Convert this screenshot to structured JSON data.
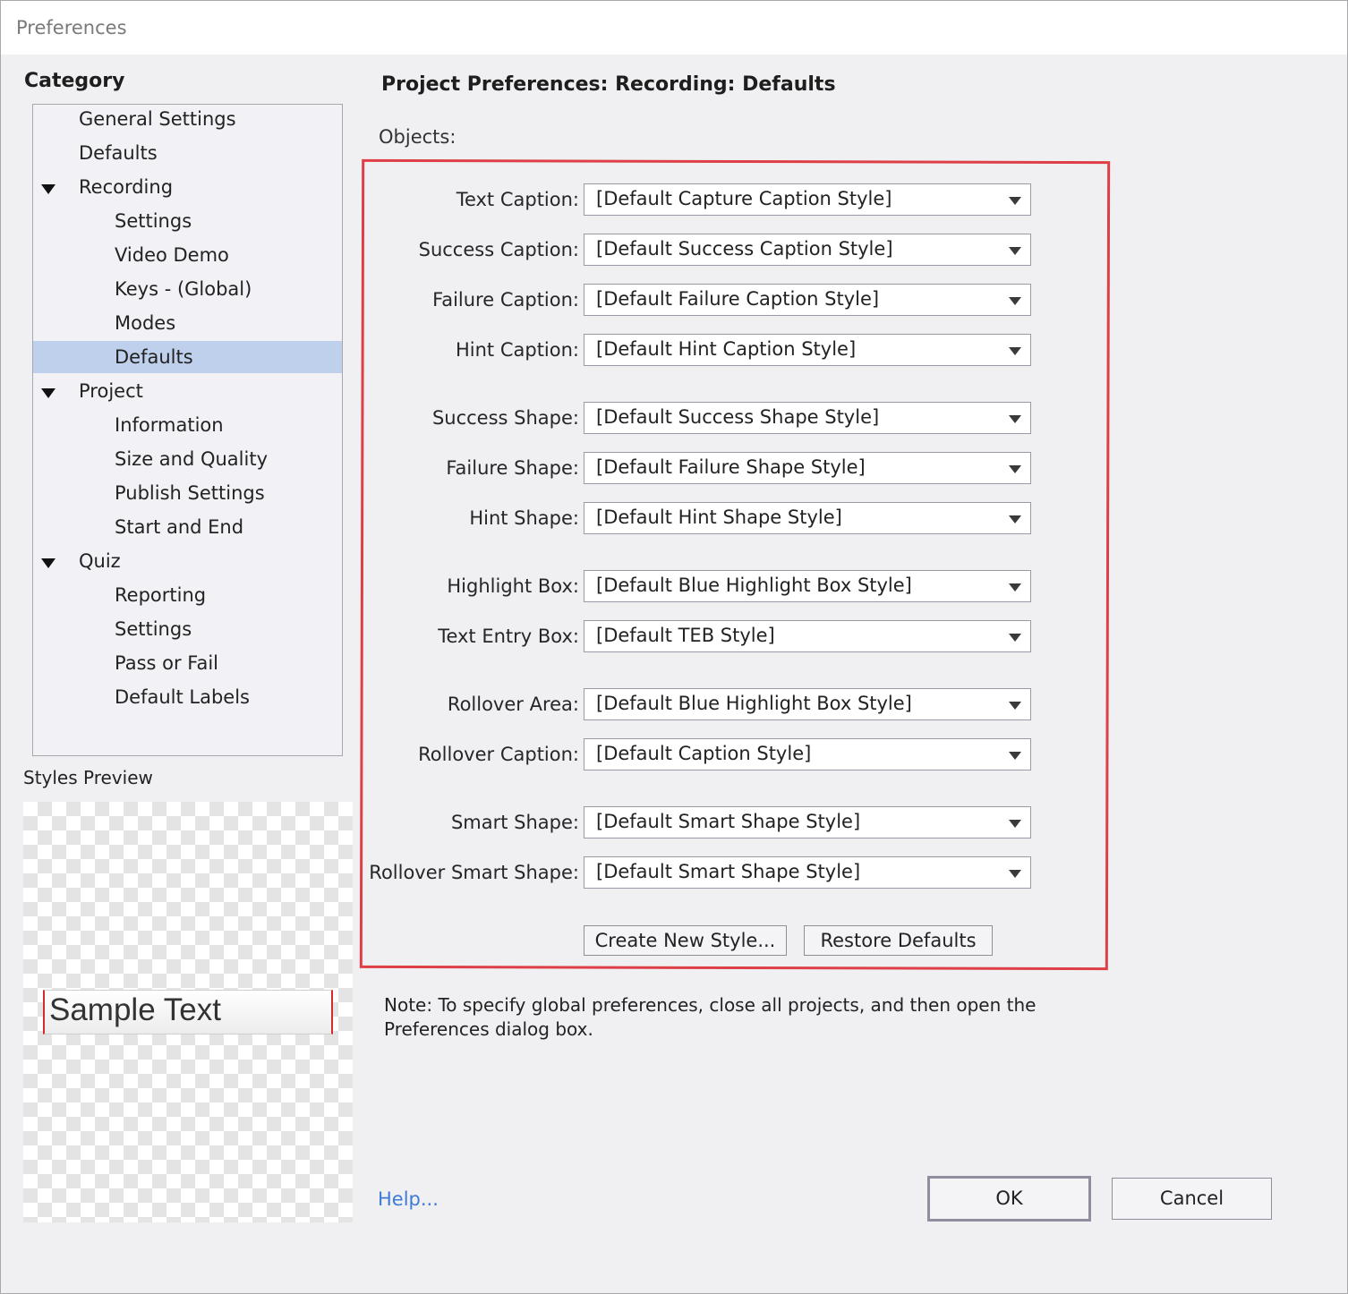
{
  "window": {
    "title": "Preferences"
  },
  "category": {
    "label": "Category",
    "items": [
      {
        "label": "General Settings",
        "level": 1,
        "expandable": false,
        "selected": false
      },
      {
        "label": "Defaults",
        "level": 1,
        "expandable": false,
        "selected": false
      },
      {
        "label": "Recording",
        "level": 1,
        "expandable": true,
        "selected": false
      },
      {
        "label": "Settings",
        "level": 2,
        "expandable": false,
        "selected": false
      },
      {
        "label": "Video Demo",
        "level": 2,
        "expandable": false,
        "selected": false
      },
      {
        "label": "Keys - (Global)",
        "level": 2,
        "expandable": false,
        "selected": false
      },
      {
        "label": "Modes",
        "level": 2,
        "expandable": false,
        "selected": false
      },
      {
        "label": "Defaults",
        "level": 2,
        "expandable": false,
        "selected": true
      },
      {
        "label": "Project",
        "level": 1,
        "expandable": true,
        "selected": false
      },
      {
        "label": "Information",
        "level": 2,
        "expandable": false,
        "selected": false
      },
      {
        "label": "Size and Quality",
        "level": 2,
        "expandable": false,
        "selected": false
      },
      {
        "label": "Publish Settings",
        "level": 2,
        "expandable": false,
        "selected": false
      },
      {
        "label": "Start and End",
        "level": 2,
        "expandable": false,
        "selected": false
      },
      {
        "label": "Quiz",
        "level": 1,
        "expandable": true,
        "selected": false
      },
      {
        "label": "Reporting",
        "level": 2,
        "expandable": false,
        "selected": false
      },
      {
        "label": "Settings",
        "level": 2,
        "expandable": false,
        "selected": false
      },
      {
        "label": "Pass or Fail",
        "level": 2,
        "expandable": false,
        "selected": false
      },
      {
        "label": "Default Labels",
        "level": 2,
        "expandable": false,
        "selected": false
      }
    ]
  },
  "styles_preview": {
    "label": "Styles Preview",
    "sample_text": "Sample Text"
  },
  "main": {
    "title": "Project Preferences: Recording: Defaults",
    "objects_label": "Objects:",
    "rows": [
      {
        "label": "Text Caption:",
        "value": "[Default Capture Caption Style]"
      },
      {
        "label": "Success Caption:",
        "value": "[Default Success Caption Style]"
      },
      {
        "label": "Failure Caption:",
        "value": "[Default Failure Caption Style]"
      },
      {
        "label": "Hint Caption:",
        "value": "[Default Hint Caption Style]"
      },
      {
        "label": "Success Shape:",
        "value": "[Default Success Shape Style]"
      },
      {
        "label": "Failure Shape:",
        "value": "[Default Failure Shape Style]"
      },
      {
        "label": "Hint Shape:",
        "value": "[Default Hint Shape Style]"
      },
      {
        "label": "Highlight Box:",
        "value": "[Default Blue Highlight Box Style]"
      },
      {
        "label": "Text Entry Box:",
        "value": "[Default TEB Style]"
      },
      {
        "label": "Rollover Area:",
        "value": "[Default Blue Highlight Box Style]"
      },
      {
        "label": "Rollover Caption:",
        "value": "[Default Caption Style]"
      },
      {
        "label": "Smart Shape:",
        "value": "[Default Smart Shape Style]"
      },
      {
        "label": "Rollover Smart Shape:",
        "value": "[Default Smart Shape Style]"
      }
    ],
    "create_new_style_label": "Create New Style...",
    "restore_defaults_label": "Restore Defaults",
    "note": "Note: To specify global preferences, close all projects, and then open the Preferences dialog box."
  },
  "footer": {
    "help_label": "Help...",
    "ok_label": "OK",
    "cancel_label": "Cancel"
  },
  "colors": {
    "selection": "#bfd0ec",
    "annotation_border": "#de3f46",
    "help_link": "#3d7bd6"
  }
}
